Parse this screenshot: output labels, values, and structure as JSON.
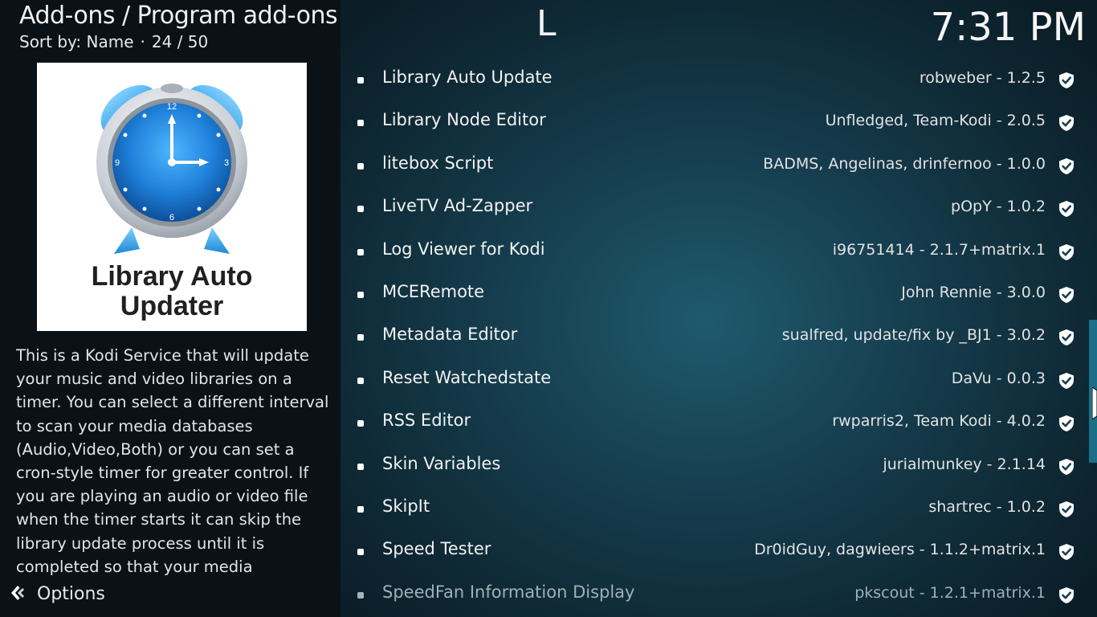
{
  "header": {
    "breadcrumb": "Add-ons / Program add-ons",
    "sort_label": "Sort by: Name",
    "separator": "·",
    "position": "24 / 50",
    "letter": "L",
    "clock": "7:31 PM"
  },
  "preview": {
    "logo_text_line1": "Library Auto",
    "logo_text_line2": "Updater",
    "icon": "alarm-clock-icon",
    "description": "This is a Kodi Service that will update your music and video libraries on a timer. You can select a different interval to scan your media databases (Audio,Video,Both) or you can set a cron-style timer for greater control. If you are playing an audio or video file when the timer starts it can skip the library update process until it is completed so that your media"
  },
  "options": {
    "label": "Options",
    "icon": "options-icon"
  },
  "addons": [
    {
      "name": "Library Auto Update",
      "meta": "robweber - 1.2.5"
    },
    {
      "name": "Library Node Editor",
      "meta": "Unfledged, Team-Kodi - 2.0.5"
    },
    {
      "name": "litebox Script",
      "meta": "BADMS, Angelinas, drinfernoo - 1.0.0"
    },
    {
      "name": "LiveTV Ad-Zapper",
      "meta": "pOpY - 1.0.2"
    },
    {
      "name": "Log Viewer for Kodi",
      "meta": "i96751414 - 2.1.7+matrix.1"
    },
    {
      "name": "MCERemote",
      "meta": "John Rennie - 3.0.0"
    },
    {
      "name": "Metadata Editor",
      "meta": "sualfred, update/fix by _BJ1 - 3.0.2"
    },
    {
      "name": "Reset Watchedstate",
      "meta": "DaVu - 0.0.3"
    },
    {
      "name": "RSS Editor",
      "meta": "rwparris2, Team Kodi - 4.0.2"
    },
    {
      "name": "Skin Variables",
      "meta": "jurialmunkey - 2.1.14"
    },
    {
      "name": "SkipIt",
      "meta": "shartrec - 1.0.2"
    },
    {
      "name": "Speed Tester",
      "meta": "Dr0idGuy, dagwieers - 1.1.2+matrix.1"
    },
    {
      "name": "SpeedFan Information Display",
      "meta": "pkscout - 1.2.1+matrix.1"
    }
  ],
  "colors": {
    "accent": "#1b6f86",
    "panel": "#0a1218",
    "background": "#163f50",
    "clock_blue": "#1e7fd8"
  }
}
